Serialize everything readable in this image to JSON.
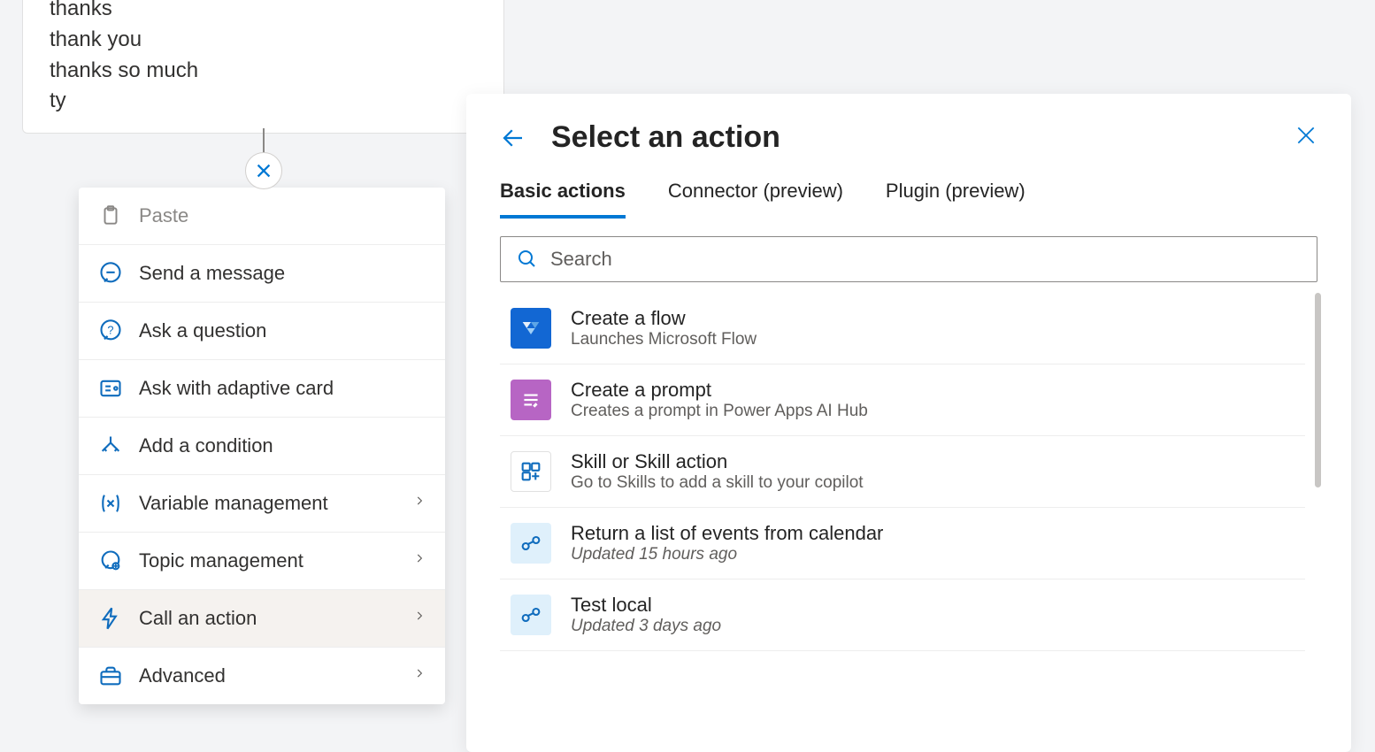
{
  "trigger": {
    "phrases": [
      "thanks",
      "thank you",
      "thanks so much",
      "ty"
    ]
  },
  "context_menu": {
    "items": [
      {
        "label": "Paste",
        "chevron": false
      },
      {
        "label": "Send a message",
        "chevron": false
      },
      {
        "label": "Ask a question",
        "chevron": false
      },
      {
        "label": "Ask with adaptive card",
        "chevron": false
      },
      {
        "label": "Add a condition",
        "chevron": false
      },
      {
        "label": "Variable management",
        "chevron": true
      },
      {
        "label": "Topic management",
        "chevron": true
      },
      {
        "label": "Call an action",
        "chevron": true,
        "selected": true
      },
      {
        "label": "Advanced",
        "chevron": true
      }
    ]
  },
  "panel": {
    "title": "Select an action",
    "tabs": [
      "Basic actions",
      "Connector (preview)",
      "Plugin (preview)"
    ],
    "active_tab": 0,
    "search_placeholder": "Search",
    "actions": [
      {
        "title": "Create a flow",
        "sub": "Launches Microsoft Flow"
      },
      {
        "title": "Create a prompt",
        "sub": "Creates a prompt in Power Apps AI Hub"
      },
      {
        "title": "Skill or Skill action",
        "sub": "Go to Skills to add a skill to your copilot"
      },
      {
        "title": "Return a list of events from calendar",
        "sub": "Updated 15 hours ago",
        "italic": true
      },
      {
        "title": "Test local",
        "sub": "Updated 3 days ago",
        "italic": true
      }
    ]
  }
}
